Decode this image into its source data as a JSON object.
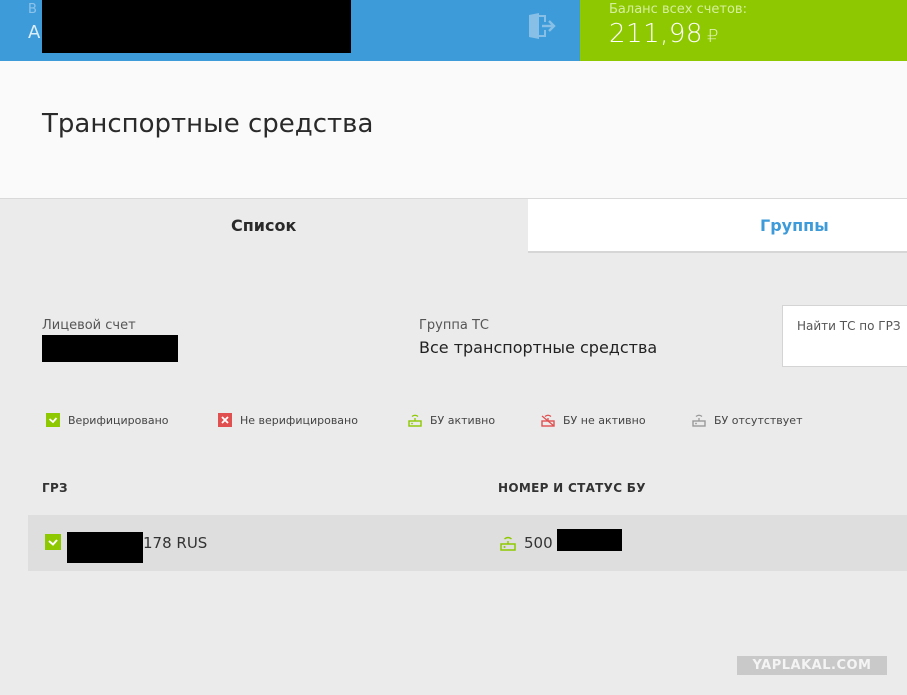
{
  "header": {
    "user_label": "В",
    "user_value": "А",
    "balance_label": "Баланс всех счетов:",
    "balance_value": "211,98",
    "currency": "₽",
    "colors": {
      "left_bar": "#3d9bd9",
      "right_bar": "#8dc800"
    }
  },
  "page": {
    "title": "Транспортные средства"
  },
  "tabs": [
    {
      "label": "Список",
      "active": true
    },
    {
      "label": "Группы",
      "active": false
    }
  ],
  "filters": {
    "account_label": "Лицевой счет",
    "group_label": "Группа ТС",
    "group_value": "Все транспортные средства",
    "search_placeholder": "Найти ТС по ГРЗ"
  },
  "legend": [
    {
      "icon": "verified-check-icon",
      "label": "Верифицировано"
    },
    {
      "icon": "not-verified-cross-icon",
      "label": "Не верифицировано"
    },
    {
      "icon": "bu-active-icon",
      "label": "БУ активно"
    },
    {
      "icon": "bu-inactive-icon",
      "label": "БУ не активно"
    },
    {
      "icon": "bu-missing-icon",
      "label": "БУ отсутствует"
    }
  ],
  "table": {
    "columns": [
      "ГРЗ",
      "НОМЕР И СТАТУС БУ"
    ],
    "rows": [
      {
        "plate_suffix": "178 RUS",
        "bu_number": "500"
      }
    ]
  },
  "watermark": "YAPLAKAL.COM"
}
